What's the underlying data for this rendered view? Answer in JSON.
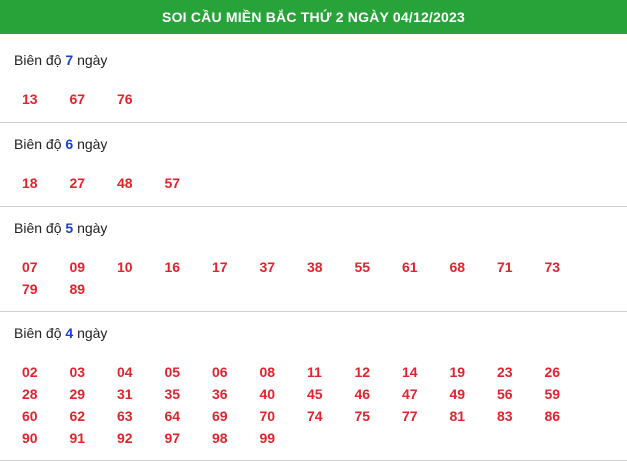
{
  "header": {
    "title": "SOI CẦU MIỀN BẮC THỨ 2 NGÀY 04/12/2023"
  },
  "sections": [
    {
      "prefix": "Biên độ",
      "n": "7",
      "suffix": "ngày",
      "numbers": [
        "13",
        "67",
        "76"
      ]
    },
    {
      "prefix": "Biên độ",
      "n": "6",
      "suffix": "ngày",
      "numbers": [
        "18",
        "27",
        "48",
        "57"
      ]
    },
    {
      "prefix": "Biên độ",
      "n": "5",
      "suffix": "ngày",
      "numbers": [
        "07",
        "09",
        "10",
        "16",
        "17",
        "37",
        "38",
        "55",
        "61",
        "68",
        "71",
        "73",
        "79",
        "89"
      ]
    },
    {
      "prefix": "Biên độ",
      "n": "4",
      "suffix": "ngày",
      "numbers": [
        "02",
        "03",
        "04",
        "05",
        "06",
        "08",
        "11",
        "12",
        "14",
        "19",
        "23",
        "26",
        "28",
        "29",
        "31",
        "35",
        "36",
        "40",
        "45",
        "46",
        "47",
        "49",
        "56",
        "59",
        "60",
        "62",
        "63",
        "64",
        "69",
        "70",
        "74",
        "75",
        "77",
        "81",
        "83",
        "86",
        "90",
        "91",
        "92",
        "97",
        "98",
        "99"
      ]
    }
  ],
  "colors": {
    "header_bg": "#27a33a",
    "number": "#e0242c",
    "count": "#1a3fd6"
  }
}
